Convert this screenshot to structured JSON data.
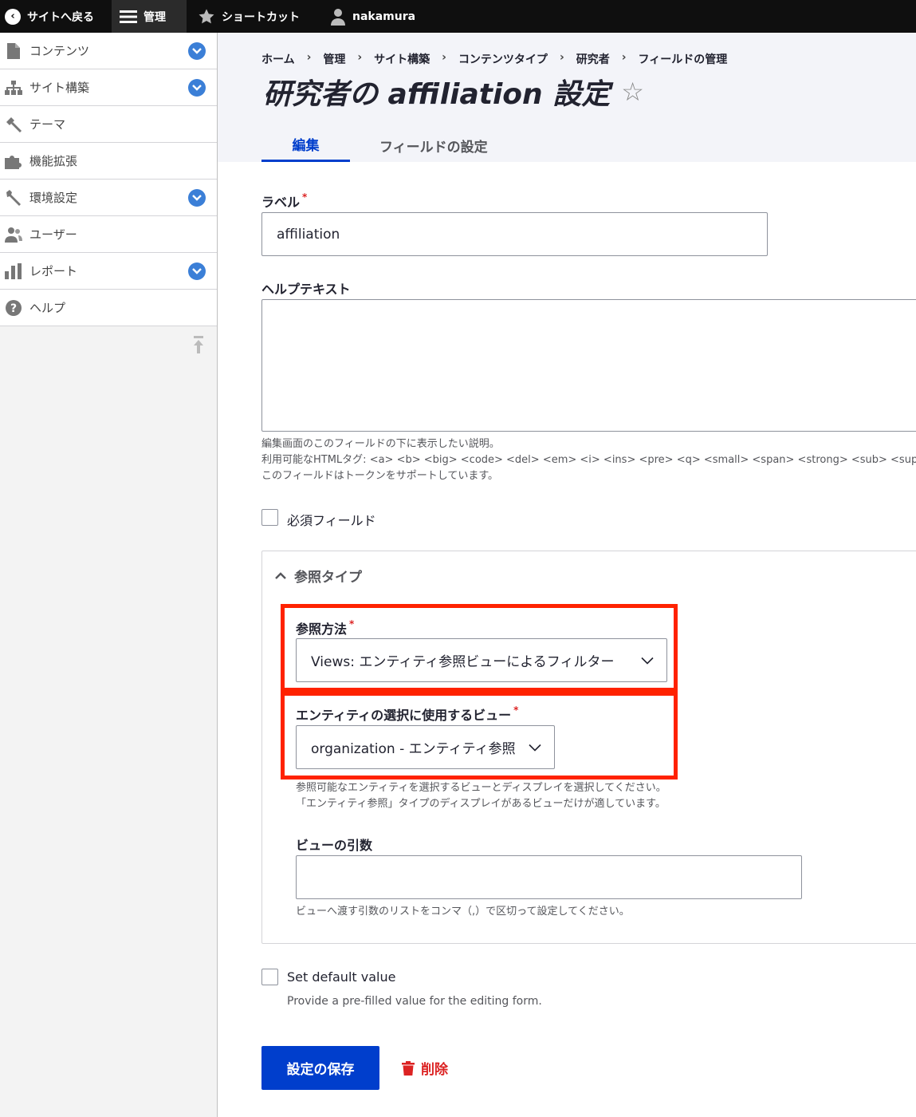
{
  "toolbar": {
    "back_label": "サイトへ戻る",
    "manage_label": "管理",
    "shortcuts_label": "ショートカット",
    "user_label": "nakamura"
  },
  "sidebar": {
    "items": [
      {
        "label": "コンテンツ",
        "icon": "file-icon",
        "expandable": true
      },
      {
        "label": "サイト構築",
        "icon": "sitemap-icon",
        "expandable": true
      },
      {
        "label": "テーマ",
        "icon": "paint-icon",
        "expandable": false
      },
      {
        "label": "機能拡張",
        "icon": "puzzle-icon",
        "expandable": false
      },
      {
        "label": "環境設定",
        "icon": "wrench-icon",
        "expandable": true
      },
      {
        "label": "ユーザー",
        "icon": "people-icon",
        "expandable": false
      },
      {
        "label": "レポート",
        "icon": "bar-chart-icon",
        "expandable": true
      },
      {
        "label": "ヘルプ",
        "icon": "help-icon",
        "expandable": false
      }
    ]
  },
  "breadcrumb": [
    "ホーム",
    "管理",
    "サイト構築",
    "コンテンツタイプ",
    "研究者",
    "フィールドの管理"
  ],
  "breadcrumb_sep": "›",
  "page_title": "研究者の affiliation 設定",
  "tabs": [
    {
      "label": "編集",
      "active": true
    },
    {
      "label": "フィールドの設定",
      "active": false
    }
  ],
  "form": {
    "label_field": {
      "label": "ラベル",
      "value": "affiliation"
    },
    "help_text": {
      "label": "ヘルプテキスト",
      "value": "",
      "desc1": "編集画面のこのフィールドの下に表示したい説明。",
      "desc2": "利用可能なHTMLタグ: <a> <b> <big> <code> <del> <em> <i> <ins> <pre> <q> <small> <span> <strong> <sub> <sup> <",
      "desc3": "このフィールドはトークンをサポートしています。"
    },
    "required": {
      "label": "必須フィールド",
      "checked": false
    },
    "reference": {
      "summary": "参照タイプ",
      "method_label": "参照方法",
      "method_value": "Views: エンティティ参照ビューによるフィルター",
      "view_label": "エンティティの選択に使用するビュー",
      "view_value": "organization - エンティティ参照",
      "view_desc1": "参照可能なエンティティを選択するビューとディスプレイを選択してください。",
      "view_desc2": "「エンティティ参照」タイプのディスプレイがあるビューだけが適しています。",
      "args_label": "ビューの引数",
      "args_value": "",
      "args_desc": "ビューへ渡す引数のリストをコンマ（,）で区切って設定してください。"
    },
    "default_value": {
      "label": "Set default value",
      "desc": "Provide a pre-filled value for the editing form.",
      "checked": false
    },
    "save_label": "設定の保存",
    "delete_label": "削除"
  },
  "colors": {
    "primary": "#003ecc",
    "danger": "#dc2323",
    "highlight": "#ff2200",
    "toolbar_bg": "#0f0f0f"
  }
}
